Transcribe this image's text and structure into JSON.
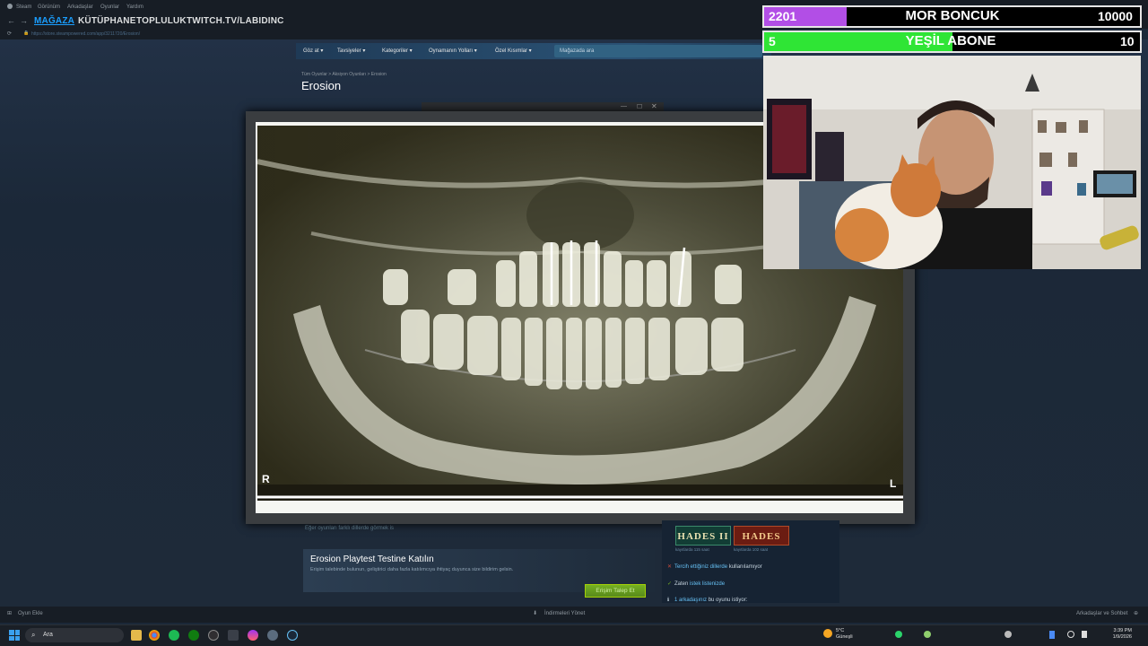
{
  "steam": {
    "menu_items": [
      "Steam",
      "Görünüm",
      "Arkadaşlar",
      "Oyunlar",
      "Yardım"
    ],
    "nav": [
      "MAĞAZA",
      "KÜTÜPHANE",
      "TOPLULUK",
      "TWITCH.TV/LABIDINC"
    ],
    "active_nav": "MAĞAZA",
    "url": "https://store.steampowered.com/app/3211720/Erosion/",
    "store_menu": [
      "Göz at ▾",
      "Tavsiyeler ▾",
      "Kategoriler ▾",
      "Oynamanın Yolları ▾",
      "Özel Kısımlar ▾"
    ],
    "search_placeholder": "Mağazada ara",
    "breadcrumb": "Tüm Oyunlar  >  Aksiyon Oyunları  >  Erosion",
    "game_title": "Erosion",
    "language_note": "Eğer oyunları farklı dillerde görmek is",
    "playtest": {
      "title": "Erosion Playtest Testine Katılın",
      "description": "Erişim talebinde bulunun, geliştirici daha fazla katılımcıya ihtiyaç duyunca size bildirim gelsin.",
      "button": "Erişim Talep Et"
    },
    "sidebar": {
      "games": [
        {
          "name": "HADES II",
          "caption": "kayıtlarda 115 saat"
        },
        {
          "name": "HADES",
          "caption": "kayıtlarda 102 saat"
        }
      ],
      "info": [
        {
          "icon": "✕",
          "prefix": "",
          "link": "Tercih ettiğiniz dillerde",
          "suffix": " kullanılamıyor"
        },
        {
          "icon": "✓",
          "prefix": "Zaten ",
          "link": "istek listenizde",
          "suffix": ""
        },
        {
          "icon": "ℹ",
          "prefix": "",
          "link": "1 arkadaşınız",
          "suffix": " bu oyunu istiyor:"
        }
      ]
    },
    "bottom": {
      "add_game": "Oyun Ekle",
      "downloads": "İndirmeleri Yönet",
      "friends": "Arkadaşlar ve Sohbet"
    }
  },
  "viewer": {
    "left_marker": "R",
    "right_marker": "L"
  },
  "overlay": {
    "bar1": {
      "left": "2201",
      "label": "MOR BONCUK",
      "right": "10000",
      "progress": 0.22,
      "color": "#b24ee6"
    },
    "bar2": {
      "left": "5",
      "label": "YEŞİL ABONE",
      "right": "10",
      "progress": 0.5,
      "color": "#2fe535"
    }
  },
  "taskbar": {
    "search": "Ara",
    "weather_temp": "5°C",
    "weather_desc": "Güneşli",
    "time": "3:39 PM",
    "date": "1/9/2026"
  },
  "colors": {
    "steam_bg": "#1b2838",
    "accent_blue": "#1a9fff",
    "button_green": "#75b022"
  }
}
